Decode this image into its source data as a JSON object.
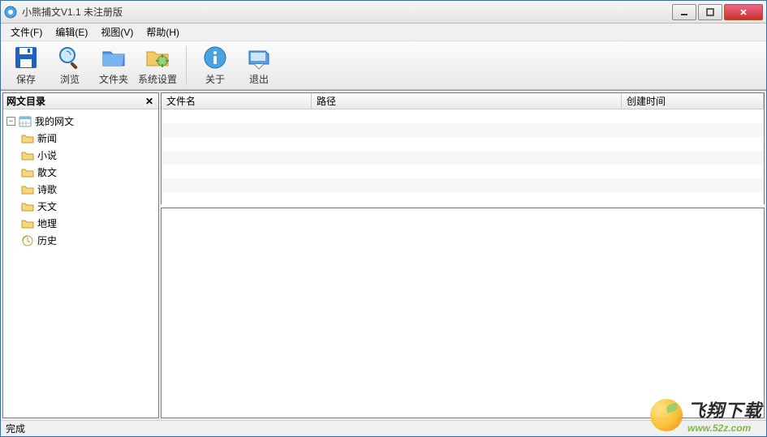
{
  "window": {
    "title": "小熊捕文V1.1 未注册版"
  },
  "menubar": {
    "items": [
      {
        "label": "文件(F)"
      },
      {
        "label": "编辑(E)"
      },
      {
        "label": "视图(V)"
      },
      {
        "label": "帮助(H)"
      }
    ]
  },
  "toolbar": {
    "items": [
      {
        "label": "保存",
        "icon": "save-icon"
      },
      {
        "label": "浏览",
        "icon": "browse-icon"
      },
      {
        "label": "文件夹",
        "icon": "folder-icon"
      },
      {
        "label": "系统设置",
        "icon": "settings-icon"
      }
    ],
    "items2": [
      {
        "label": "关于",
        "icon": "about-icon"
      },
      {
        "label": "退出",
        "icon": "exit-icon"
      }
    ]
  },
  "tree": {
    "title": "网文目录",
    "root": {
      "label": "我的网文"
    },
    "children": [
      {
        "label": "新闻"
      },
      {
        "label": "小说"
      },
      {
        "label": "散文"
      },
      {
        "label": "诗歌"
      },
      {
        "label": "天文"
      },
      {
        "label": "地理"
      },
      {
        "label": "历史"
      }
    ]
  },
  "list": {
    "columns": {
      "filename": "文件名",
      "path": "路径",
      "created": "创建时间"
    }
  },
  "status": {
    "text": "完成"
  },
  "watermark": {
    "big": "飞翔下载",
    "small": "www.52z.com"
  }
}
